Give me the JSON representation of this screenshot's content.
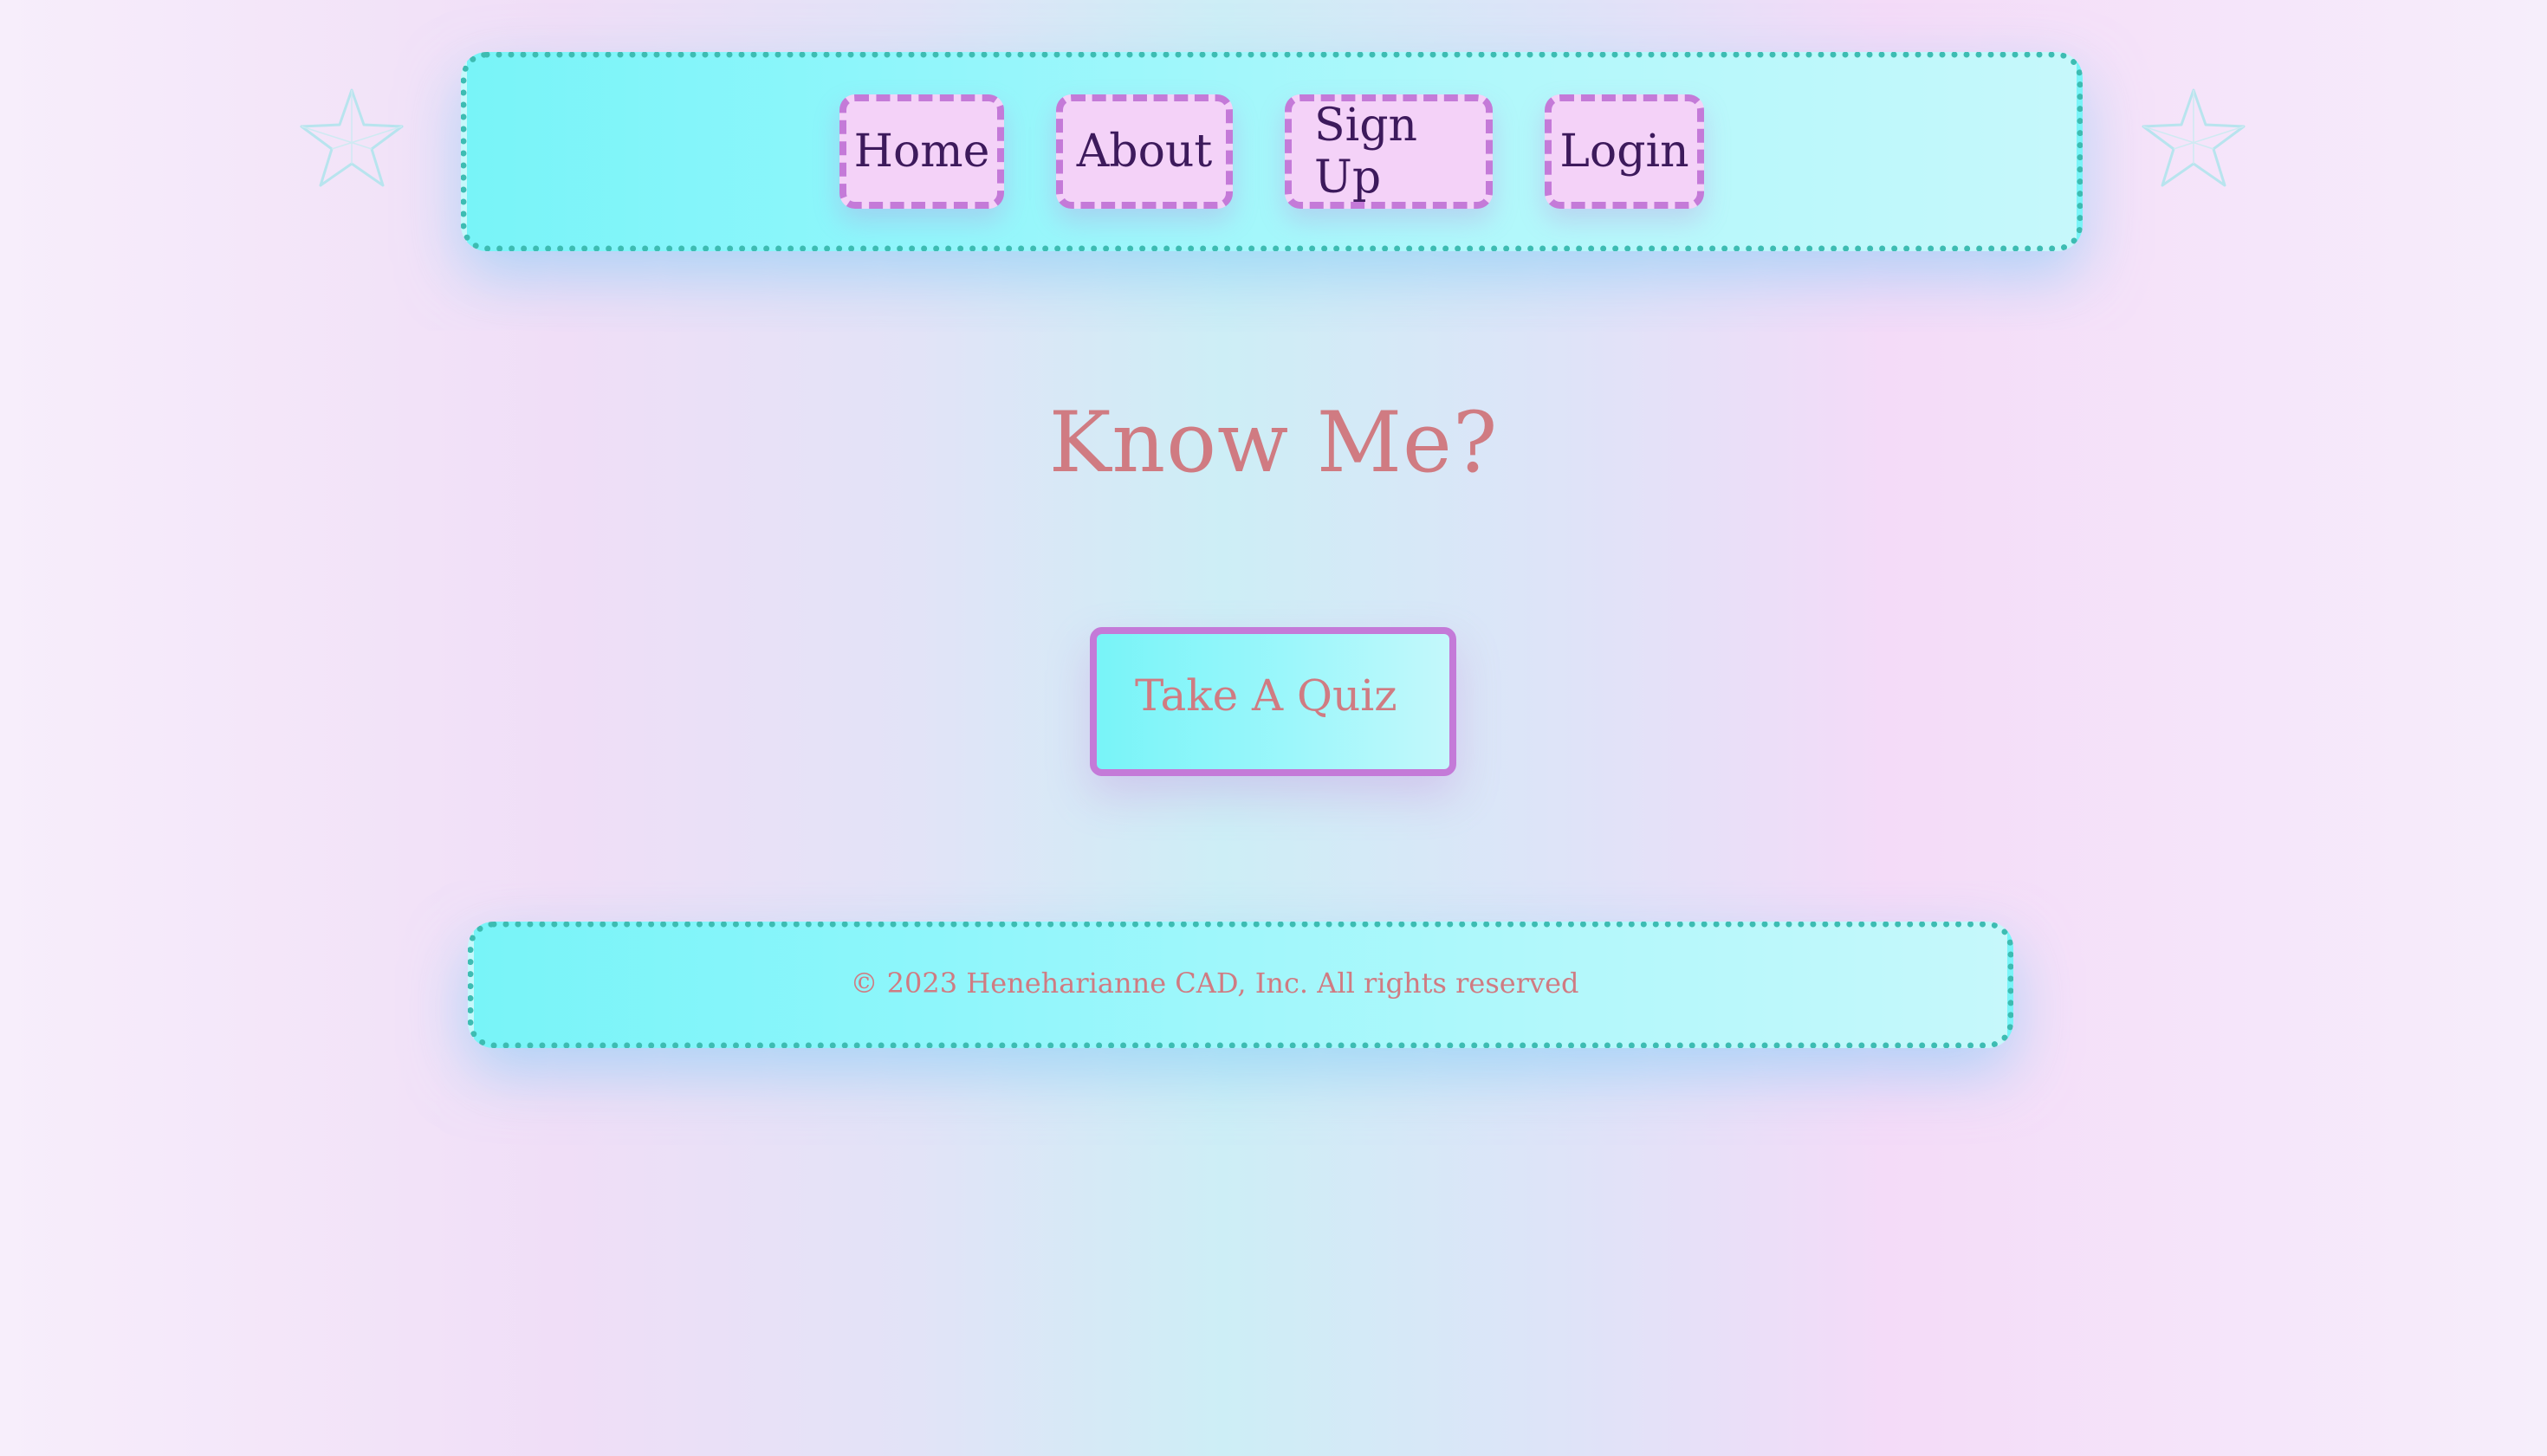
{
  "nav": {
    "items": [
      {
        "label": "Home"
      },
      {
        "label": "About"
      },
      {
        "label": "Sign Up"
      },
      {
        "label": "Login"
      }
    ]
  },
  "main": {
    "title": "Know Me?",
    "quiz_button_label": "Take A Quiz"
  },
  "footer": {
    "copyright": "© 2023 Heneharianne CAD, Inc. All rights reserved"
  },
  "icons": {
    "decor_left": "star-outline-icon",
    "decor_right": "star-outline-icon"
  },
  "colors": {
    "nav_border": "#3dbcb2",
    "nav_bg": "#78f4f8",
    "button_border": "#c47ad8",
    "button_bg": "#f4d2f8",
    "nav_text": "#3d1a5c",
    "accent_text": "#d07b82",
    "star_stroke": "#b8e4ee"
  }
}
